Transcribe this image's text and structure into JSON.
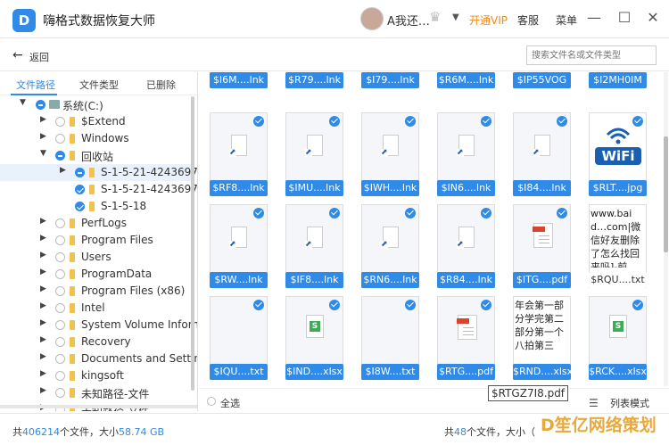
{
  "app": {
    "title": "嗨格式数据恢复大师",
    "logo_letter": "D"
  },
  "header": {
    "user": "A我还…",
    "vip": "开通VIP",
    "service": "客服",
    "menu": "菜单",
    "min": "—",
    "max": "☐",
    "close": "✕"
  },
  "nav": {
    "back_label": "返回",
    "search_placeholder": "搜索文件名或文件类型"
  },
  "tabs": [
    {
      "label": "文件路径"
    },
    {
      "label": "文件类型"
    },
    {
      "label": "已删除"
    }
  ],
  "tree": [
    {
      "label": "系统(C:)"
    },
    {
      "label": "$Extend"
    },
    {
      "label": "Windows"
    },
    {
      "label": "回收站"
    },
    {
      "label": "S-1-5-21-42436977"
    },
    {
      "label": "S-1-5-21-42436977"
    },
    {
      "label": "S-1-5-18"
    },
    {
      "label": "PerfLogs"
    },
    {
      "label": "Program Files"
    },
    {
      "label": "Users"
    },
    {
      "label": "ProgramData"
    },
    {
      "label": "Program Files (x86)"
    },
    {
      "label": "Intel"
    },
    {
      "label": "System Volume Inform"
    },
    {
      "label": "Recovery"
    },
    {
      "label": "Documents and Setting"
    },
    {
      "label": "kingsoft"
    },
    {
      "label": "未知路径-文件"
    },
    {
      "label": "未知路径-文件"
    }
  ],
  "grid": {
    "row0": [
      "$I6M....lnk",
      "$R79....lnk",
      "$I79....lnk",
      "$R6M....lnk",
      "$IP55VOG",
      "$I2MH0IM"
    ],
    "row1": [
      "$RF8....lnk",
      "$IMU....lnk",
      "$IWH....lnk",
      "$IN6....lnk",
      "$I84....lnk",
      "$RLT....jpg"
    ],
    "row2": [
      "$RW....lnk",
      "$IF8....lnk",
      "$RN6....lnk",
      "$R84....lnk",
      "$ITG....pdf",
      "$RQU....txt"
    ],
    "row3": [
      "$IQU....txt",
      "$IND....xlsx",
      "$I8W....txt",
      "$RTG....pdf",
      "$RND....xlsx",
      "$RCK....xlsx"
    ],
    "preview_row2": "www.baid…com|微信好友删除了怎么找回来吗]-前",
    "preview_row3": "年会第一部分学完第二部分第一个八拍第三",
    "wifi_text": "WiFi",
    "pdf_band": "PDF"
  },
  "footer": {
    "select_all": "全选",
    "tooltip": "$RTGZ7I8.pdf",
    "list_mode": "列表模式",
    "total_prefix": "共",
    "total_count": "406214",
    "total_mid": "个文件，大小",
    "total_size": "58.74 GB",
    "sel_prefix": "共",
    "sel_count": "48",
    "sel_suffix": "个文件，大小（",
    "watermark": "D笙亿网络策划"
  }
}
